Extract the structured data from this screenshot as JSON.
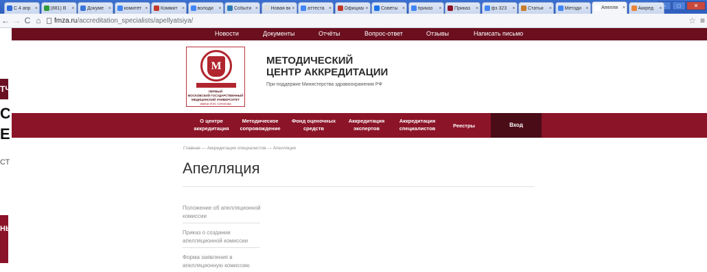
{
  "browser": {
    "tabs": [
      {
        "label": "С 4 апр",
        "color": "#2d6ad8"
      },
      {
        "label": "(881) В",
        "color": "#2f9b3a"
      },
      {
        "label": "Докуме",
        "color": "#3a75d8"
      },
      {
        "label": "комитет",
        "color": "#4285f4"
      },
      {
        "label": "Коммит",
        "color": "#c0392b"
      },
      {
        "label": "володи",
        "color": "#4285f4"
      },
      {
        "label": "Событи",
        "color": "#2c7bb6"
      },
      {
        "label": "Новая вкл",
        "color": "#dddddd"
      },
      {
        "label": "аттеста",
        "color": "#4285f4"
      },
      {
        "label": "Официал",
        "color": "#c0392b"
      },
      {
        "label": "Советы",
        "color": "#1a73e8"
      },
      {
        "label": "приказ",
        "color": "#4285f4"
      },
      {
        "label": "Приказ",
        "color": "#8c1428"
      },
      {
        "label": "фз 323",
        "color": "#4285f4"
      },
      {
        "label": "Статьи",
        "color": "#c77d2b"
      },
      {
        "label": "Методи",
        "color": "#4285f4"
      },
      {
        "label": "Апелля",
        "color": "#ffffff"
      },
      {
        "label": "Аккред",
        "color": "#e8863a"
      }
    ],
    "active_tab_index": 16,
    "url_host": "fmza.ru",
    "url_path": "/accreditation_specialists/apellyatsiya/"
  },
  "left_window": {
    "red_text": "ТЧ",
    "big1": "СК",
    "big2": "Е",
    "small": "СТ",
    "red2_text": "НЫ"
  },
  "site": {
    "topnav": [
      "Новости",
      "Документы",
      "Отчёты",
      "Вопрос-ответ",
      "Отзывы",
      "Написать письмо"
    ],
    "logo_text": {
      "ribbon": "И.М. СЕЧЕНОВА",
      "line1": "ПЕРВЫЙ",
      "line2": "МОСКОВСКИЙ ГОСУДАРСТВЕННЫЙ",
      "line3": "МЕДИЦИНСКИЙ УНИВЕРСИТЕТ",
      "line4": "имени И.М. Сеченова"
    },
    "brand_line1": "МЕТОДИЧЕСКИЙ",
    "brand_line2": "ЦЕНТР АККРЕДИТАЦИИ",
    "brand_sub": "При поддержке Министерства здравоохранения РФ",
    "mainnav": [
      {
        "l1": "О центре",
        "l2": "аккредитация"
      },
      {
        "l1": "Методическое",
        "l2": "сопровождение"
      },
      {
        "l1": "Фонд оценочных",
        "l2": "средств"
      },
      {
        "l1": "Аккредитация",
        "l2": "экспертов"
      },
      {
        "l1": "Аккредитация",
        "l2": "специалистов"
      },
      {
        "l1": "Реестры",
        "l2": ""
      }
    ],
    "login_label": "Вход",
    "breadcrumbs": "Главная  —  Аккредитация специалистов  —  Апелляция",
    "page_title": "Апелляция",
    "side_links": [
      {
        "l1": "Положение об апелляционной",
        "l2": "комиссии"
      },
      {
        "l1": "Приказ о создании",
        "l2": "апелляционной комиссии"
      },
      {
        "l1": "Форма заявления в",
        "l2": "апелляционную комиссию"
      }
    ]
  }
}
